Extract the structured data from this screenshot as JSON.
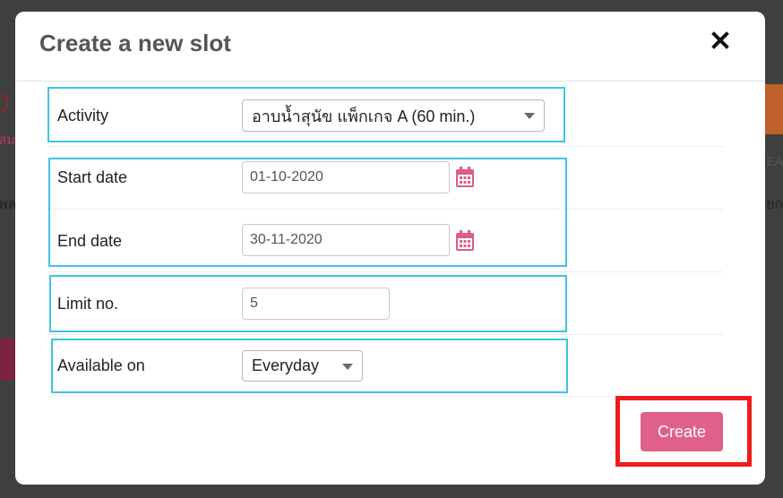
{
  "modal": {
    "title": "Create a new slot",
    "close_icon": "close-icon"
  },
  "form": {
    "activity": {
      "label": "Activity",
      "selected": "อาบน้ำสุนัข แพ็กเกจ A (60 min.)"
    },
    "start_date": {
      "label": "Start date",
      "value": "01-10-2020",
      "icon": "calendar-icon"
    },
    "end_date": {
      "label": "End date",
      "value": "30-11-2020",
      "icon": "calendar-icon"
    },
    "limit": {
      "label": "Limit no.",
      "value": "5"
    },
    "available_on": {
      "label": "Available on",
      "selected": "Everyday"
    }
  },
  "actions": {
    "create_label": "Create"
  },
  "colors": {
    "accent": "#e0608c",
    "highlight_box": "#3cc6e1",
    "annotation_red": "#ee1c1c"
  }
}
